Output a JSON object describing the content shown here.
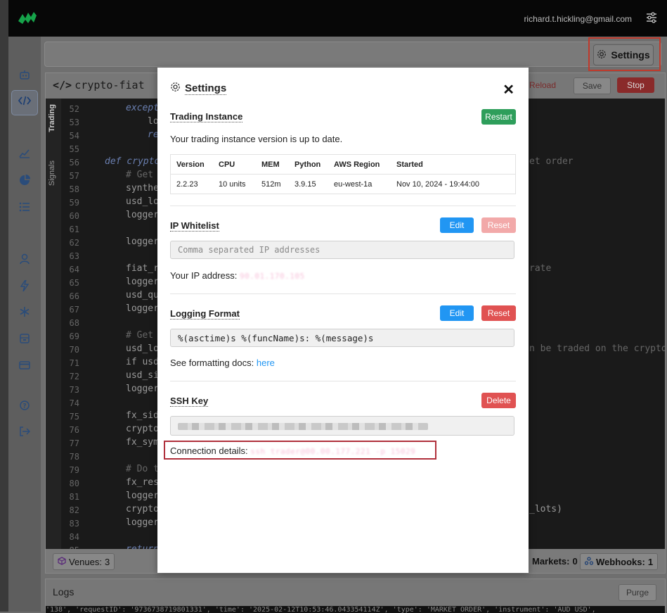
{
  "user": {
    "email": "richard.t.hickling@gmail.com"
  },
  "toolbar": {
    "settings_label": "Settings"
  },
  "editor": {
    "file_name": "crypto-fiat",
    "reload_label": "Reload",
    "save_label": "Save",
    "stop_label": "Stop",
    "vtabs": {
      "trading": "Trading",
      "signals": "Signals"
    },
    "line_numbers": [
      "52",
      "53",
      "54",
      "55",
      "56",
      "57",
      "58",
      "59",
      "60",
      "61",
      "62",
      "63",
      "64",
      "65",
      "66",
      "67",
      "68",
      "69",
      "70",
      "71",
      "72",
      "73",
      "74",
      "75",
      "76",
      "77",
      "78",
      "79",
      "80",
      "81",
      "82",
      "83",
      "84",
      "85"
    ],
    "code_fragments": {
      "l52": "except",
      "l53": "lo",
      "l54": "re",
      "l56": "def crypto",
      "l56_right": "et order",
      "l57": "# Get",
      "l58": "synthe",
      "l59": "usd_lo",
      "l60": "logger",
      "l62": "logger",
      "l64": "fiat_r",
      "l64_right": "rate",
      "l65": "logger",
      "l66": "usd_qu",
      "l67": "logger",
      "l69": "# Get",
      "l70": "usd_lo",
      "l70_right": "n be traded on the crypto",
      "l71": "if usd",
      "l72": "usd_si",
      "l73": "logger",
      "l75": "fx_sid",
      "l76": "crypto",
      "l77": "fx_sym",
      "l79": "# Do t",
      "l80": "fx_res",
      "l81": "logger",
      "l82": "crypto",
      "l82_right": "_lots)",
      "l83": "logger",
      "l85": "return"
    }
  },
  "footer": {
    "venues_label": "Venues:",
    "venues_count": "3",
    "markets_label": "Markets:",
    "markets_count": "0",
    "webhooks_label": "Webhooks:",
    "webhooks_count": "1"
  },
  "logs": {
    "title": "Logs",
    "purge_label": "Purge",
    "line": "'138', 'requestID': '9736738719801331', 'time': '2025-02-12T10:53:46.043354114Z', 'type': 'MARKET_ORDER', 'instrument': 'AUD_USD',"
  },
  "modal": {
    "title": "Settings",
    "close": "✕",
    "trading_instance": {
      "title": "Trading Instance",
      "restart_label": "Restart",
      "status": "Your trading instance version is up to date.",
      "headers": [
        "Version",
        "CPU",
        "MEM",
        "Python",
        "AWS Region",
        "Started"
      ],
      "values": [
        "2.2.23",
        "10 units",
        "512m",
        "3.9.15",
        "eu-west-1a",
        "Nov 10, 2024 - 19:44:00"
      ]
    },
    "ip_whitelist": {
      "title": "IP Whitelist",
      "edit_label": "Edit",
      "reset_label": "Reset",
      "placeholder": "Comma separated IP addresses",
      "your_ip_label": "Your IP address:",
      "your_ip_value": "90.01.170.105"
    },
    "logging_format": {
      "title": "Logging Format",
      "edit_label": "Edit",
      "reset_label": "Reset",
      "value": "%(asctime)s %(funcName)s: %(message)s",
      "docs_label": "See formatting docs:",
      "docs_link": "here"
    },
    "ssh_key": {
      "title": "SSH Key",
      "delete_label": "Delete",
      "connection_label": "Connection details:",
      "connection_value": "ssh trader@00.00.177.221 -p 15029"
    }
  },
  "colors": {
    "restart": "#2e9e5b",
    "edit": "#2196f3",
    "reset": "#e05252",
    "highlight_box": "#c0392b",
    "link": "#2196f3"
  }
}
